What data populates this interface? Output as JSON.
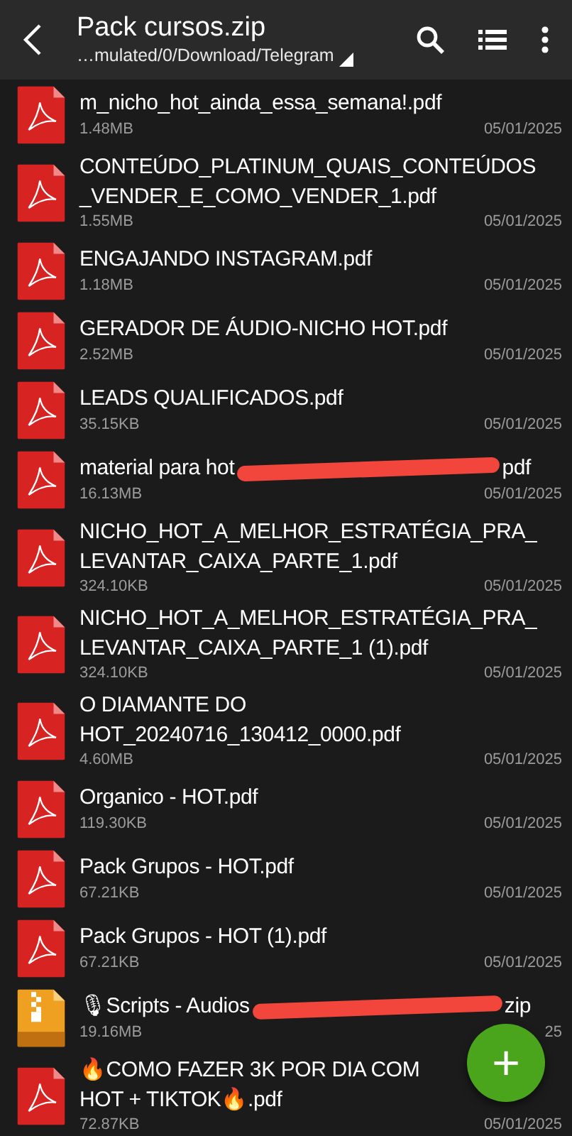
{
  "toolbar": {
    "title": "Pack cursos.zip",
    "path": "…mulated/0/Download/Telegram"
  },
  "files": [
    {
      "kind": "pdf",
      "name_lines": [
        "m_nicho_hot_ainda_essa_semana!.pdf"
      ],
      "size": "1.48MB",
      "date": "05/01/2025"
    },
    {
      "kind": "pdf",
      "name_lines": [
        "CONTEÚDO_PLATINUM_QUAIS_CONTEÚDOS",
        "_VENDER_E_COMO_VENDER_1.pdf"
      ],
      "size": "1.55MB",
      "date": "05/01/2025"
    },
    {
      "kind": "pdf",
      "name_lines": [
        "ENGAJANDO INSTAGRAM.pdf"
      ],
      "size": "1.18MB",
      "date": "05/01/2025"
    },
    {
      "kind": "pdf",
      "name_lines": [
        "GERADOR DE ÁUDIO-NICHO HOT.pdf"
      ],
      "size": "2.52MB",
      "date": "05/01/2025"
    },
    {
      "kind": "pdf",
      "name_lines": [
        "LEADS QUALIFICADOS.pdf"
      ],
      "size": "35.15KB",
      "date": "05/01/2025"
    },
    {
      "kind": "pdf",
      "name_lines": [
        "material para hot"
      ],
      "redacted": true,
      "suffix": "pdf",
      "size": "16.13MB",
      "date": "05/01/2025"
    },
    {
      "kind": "pdf",
      "name_lines": [
        "NICHO_HOT_A_MELHOR_ESTRATÉGIA_PRA_",
        "LEVANTAR_CAIXA_PARTE_1.pdf"
      ],
      "size": "324.10KB",
      "date": "05/01/2025"
    },
    {
      "kind": "pdf",
      "name_lines": [
        "NICHO_HOT_A_MELHOR_ESTRATÉGIA_PRA_",
        "LEVANTAR_CAIXA_PARTE_1 (1).pdf"
      ],
      "size": "324.10KB",
      "date": "05/01/2025"
    },
    {
      "kind": "pdf",
      "name_lines": [
        "O DIAMANTE DO",
        "HOT_20240716_130412_0000.pdf"
      ],
      "size": "4.60MB",
      "date": "05/01/2025"
    },
    {
      "kind": "pdf",
      "name_lines": [
        "Organico - HOT.pdf"
      ],
      "size": "119.30KB",
      "date": "05/01/2025"
    },
    {
      "kind": "pdf",
      "name_lines": [
        "Pack Grupos - HOT.pdf"
      ],
      "size": "67.21KB",
      "date": "05/01/2025"
    },
    {
      "kind": "pdf",
      "name_lines": [
        "Pack Grupos - HOT (1).pdf"
      ],
      "size": "67.21KB",
      "date": "05/01/2025"
    },
    {
      "kind": "zip",
      "name_lines": [
        "🎙Scripts - Audios"
      ],
      "redacted": true,
      "suffix": "zip",
      "size": "19.16MB",
      "date": "25"
    },
    {
      "kind": "pdf",
      "name_lines": [
        "🔥COMO FAZER 3K POR DIA COM",
        "HOT + TIKTOK🔥.pdf"
      ],
      "size": "72.87KB",
      "date": "05/01/2025"
    }
  ],
  "fab": {
    "label": "+"
  }
}
